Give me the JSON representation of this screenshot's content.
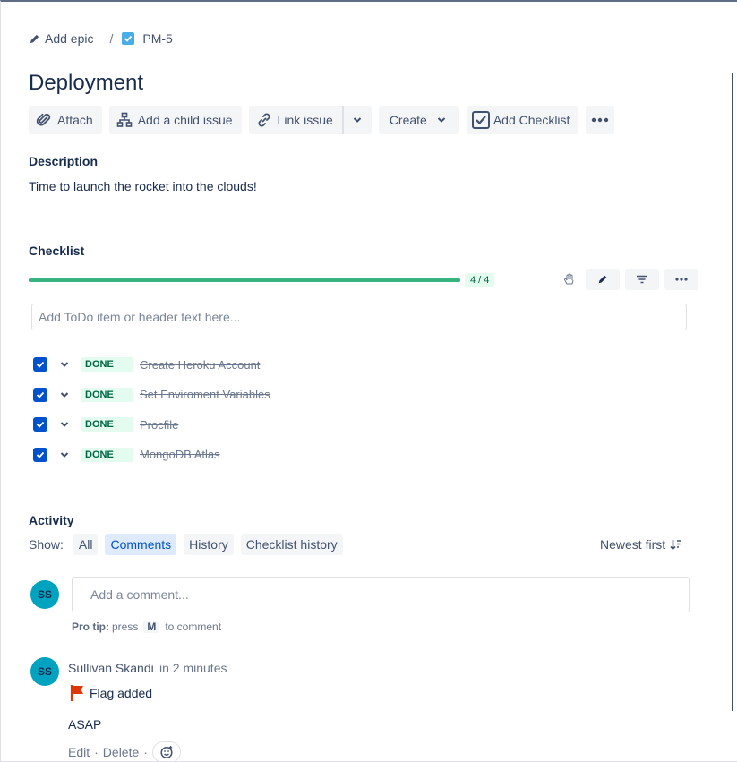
{
  "breadcrumb": {
    "epic_label": "Add epic",
    "separator": "/",
    "issue_key": "PM-5"
  },
  "issue": {
    "title": "Deployment"
  },
  "toolbar": {
    "attach": "Attach",
    "add_child": "Add a child issue",
    "link_issue": "Link issue",
    "create": "Create",
    "add_checklist": "Add Checklist"
  },
  "description": {
    "heading": "Description",
    "text": "Time to launch the rocket into the clouds!"
  },
  "checklist": {
    "heading": "Checklist",
    "progress_label": "4 / 4",
    "progress_fraction": 1.0,
    "add_placeholder": "Add ToDo item or header text here...",
    "items": [
      {
        "status": "DONE",
        "label": "Create Heroku Account",
        "checked": true
      },
      {
        "status": "DONE",
        "label": "Set Enviroment Variables",
        "checked": true
      },
      {
        "status": "DONE",
        "label": "Procfile",
        "checked": true
      },
      {
        "status": "DONE",
        "label": "MongoDB Atlas",
        "checked": true
      }
    ]
  },
  "activity": {
    "heading": "Activity",
    "show_label": "Show:",
    "filters": [
      "All",
      "Comments",
      "History",
      "Checklist history"
    ],
    "active_filter": "Comments",
    "sort_label": "Newest first",
    "comment_placeholder": "Add a comment...",
    "current_user_initials": "SS",
    "protip": {
      "label": "Pro tip:",
      "press": "press",
      "key": "M",
      "suffix": "to comment"
    }
  },
  "comment": {
    "initials": "SS",
    "author": "Sullivan Skandi",
    "time": "in 2 minutes",
    "flag_text": "Flag added",
    "body": "ASAP",
    "edit": "Edit",
    "delete": "Delete",
    "dot": "·"
  },
  "colors": {
    "accent": "#0052cc",
    "done_bg": "#e3fcef",
    "done_text": "#006644",
    "progress": "#36b37e",
    "avatar": "#00a3bf",
    "flag": "#de350b"
  }
}
